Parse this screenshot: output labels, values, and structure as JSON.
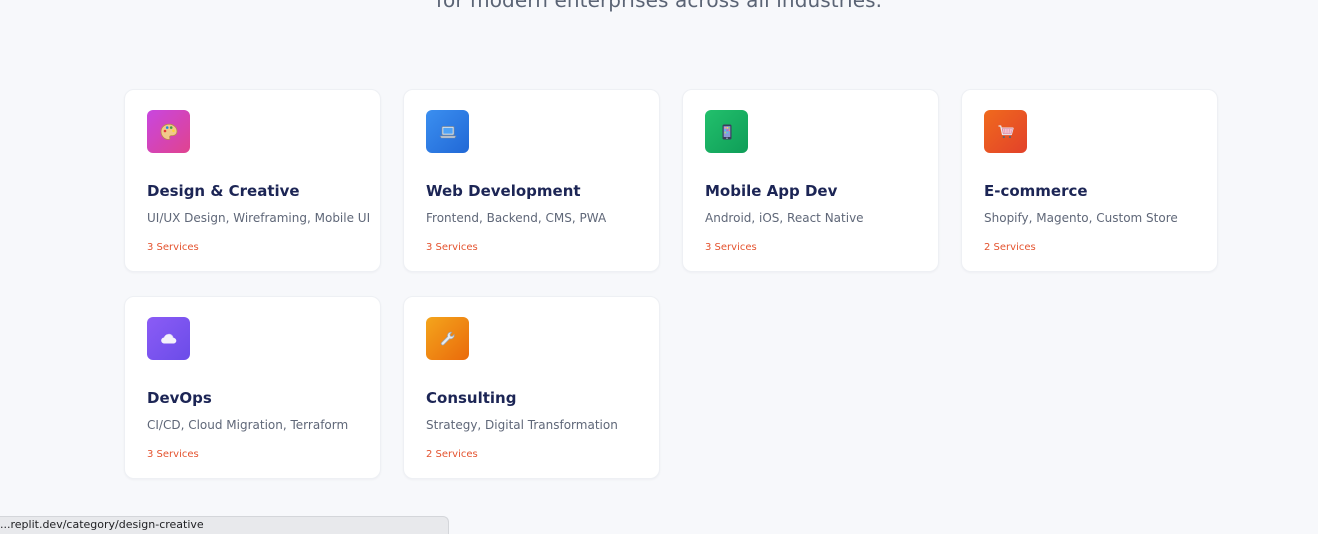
{
  "hero": {
    "subtitle": "for modern enterprises across all industries."
  },
  "categories": [
    {
      "title": "Design & Creative",
      "description": "UI/UX Design, Wireframing, Mobile UI",
      "count": "3 Services",
      "icon": "palette-icon",
      "color_from": "#c846e0",
      "color_to": "#e0438e"
    },
    {
      "title": "Web Development",
      "description": "Frontend, Backend, CMS, PWA",
      "count": "3 Services",
      "icon": "laptop-icon",
      "color_from": "#3b8ff0",
      "color_to": "#2168d6"
    },
    {
      "title": "Mobile App Dev",
      "description": "Android, iOS, React Native",
      "count": "3 Services",
      "icon": "mobile-phone-icon",
      "color_from": "#22c06c",
      "color_to": "#0f9d58"
    },
    {
      "title": "E-commerce",
      "description": "Shopify, Magento, Custom Store",
      "count": "2 Services",
      "icon": "shopping-cart-icon",
      "color_from": "#f06a1d",
      "color_to": "#e2412a"
    },
    {
      "title": "DevOps",
      "description": "CI/CD, Cloud Migration, Terraform",
      "count": "3 Services",
      "icon": "cloud-icon",
      "color_from": "#8b5cf6",
      "color_to": "#6b4ce8"
    },
    {
      "title": "Consulting",
      "description": "Strategy, Digital Transformation",
      "count": "2 Services",
      "icon": "wrench-icon",
      "color_from": "#f4a51c",
      "color_to": "#ea6a0b"
    }
  ],
  "status_bar": {
    "url": "...replit.dev/category/design-creative"
  }
}
